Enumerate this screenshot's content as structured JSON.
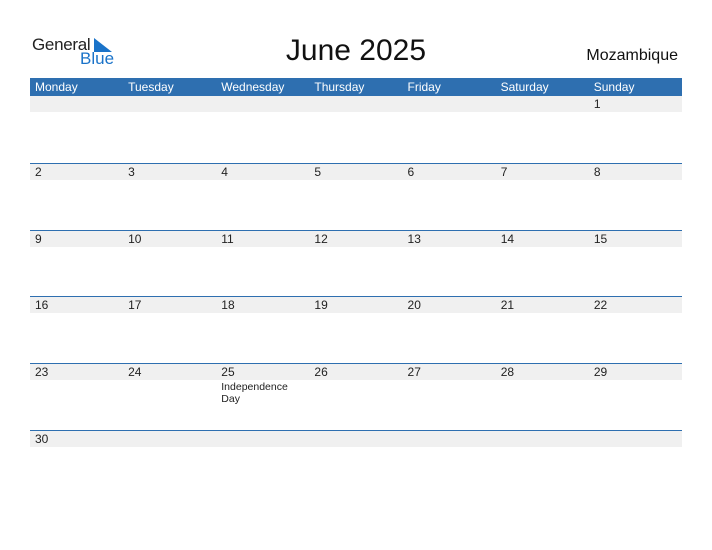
{
  "logo": {
    "part1": "General",
    "part2": "Blue"
  },
  "title": "June 2025",
  "country": "Mozambique",
  "weekdays": [
    "Monday",
    "Tuesday",
    "Wednesday",
    "Thursday",
    "Friday",
    "Saturday",
    "Sunday"
  ],
  "weeks": [
    [
      "",
      "",
      "",
      "",
      "",
      "",
      "1"
    ],
    [
      "2",
      "3",
      "4",
      "5",
      "6",
      "7",
      "8"
    ],
    [
      "9",
      "10",
      "11",
      "12",
      "13",
      "14",
      "15"
    ],
    [
      "16",
      "17",
      "18",
      "19",
      "20",
      "21",
      "22"
    ],
    [
      "23",
      "24",
      "25",
      "26",
      "27",
      "28",
      "29"
    ],
    [
      "30",
      "",
      "",
      "",
      "",
      "",
      ""
    ]
  ],
  "holidays": [
    {
      "week": 4,
      "day": 2,
      "name": "Independence Day"
    }
  ],
  "colors": {
    "accent": "#2e6fb0",
    "logo_blue": "#1a73c9",
    "date_strip": "#f0f0f0"
  }
}
